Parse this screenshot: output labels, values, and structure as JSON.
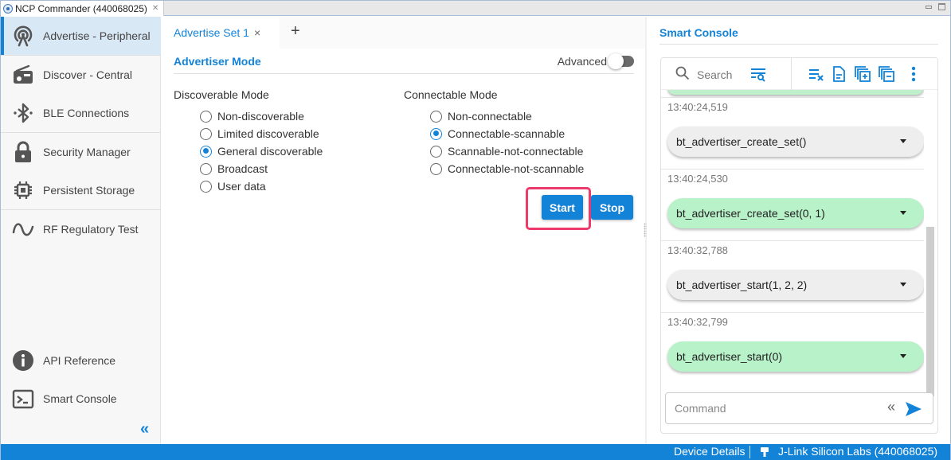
{
  "window": {
    "view_tab_title": "NCP Commander (440068025)"
  },
  "sidebar": {
    "items": [
      {
        "label": "Advertise - Peripheral",
        "icon": "broadcast-icon",
        "active": true
      },
      {
        "label": "Discover - Central",
        "icon": "radio-icon"
      },
      {
        "label": "BLE Connections",
        "icon": "bluetooth-icon"
      },
      {
        "label": "Security Manager",
        "icon": "lock-icon"
      },
      {
        "label": "Persistent Storage",
        "icon": "chip-icon"
      },
      {
        "label": "RF Regulatory Test",
        "icon": "sine-wave-icon"
      }
    ],
    "bottom_items": [
      {
        "label": "API Reference",
        "icon": "info-icon"
      },
      {
        "label": "Smart Console",
        "icon": "terminal-icon"
      }
    ],
    "collapse_glyph": "«"
  },
  "main": {
    "tabs": [
      {
        "label": "Advertise Set 1",
        "close": "×"
      }
    ],
    "add_tab": "+",
    "section_title": "Advertiser Mode",
    "advanced_label": "Advanced",
    "advanced_enabled": false,
    "discoverable": {
      "label": "Discoverable Mode",
      "options": [
        "Non-discoverable",
        "Limited discoverable",
        "General discoverable",
        "Broadcast",
        "User data"
      ],
      "selected": "General discoverable"
    },
    "connectable": {
      "label": "Connectable Mode",
      "options": [
        "Non-connectable",
        "Connectable-scannable",
        "Scannable-not-connectable",
        "Connectable-not-scannable"
      ],
      "selected": "Connectable-scannable"
    },
    "start_label": "Start",
    "stop_label": "Stop"
  },
  "console": {
    "title": "Smart Console",
    "search_placeholder": "Search",
    "entries": [
      {
        "timestamp": "13:40:24,519",
        "text": "bt_advertiser_create_set()",
        "kind": "command"
      },
      {
        "timestamp": "13:40:24,530",
        "text": "bt_advertiser_create_set(0, 1)",
        "kind": "response"
      },
      {
        "timestamp": "13:40:32,788",
        "text": "bt_advertiser_start(1, 2, 2)",
        "kind": "command"
      },
      {
        "timestamp": "13:40:32,799",
        "text": "bt_advertiser_start(0)",
        "kind": "response"
      }
    ],
    "command_placeholder": "Command",
    "history_glyph": "«"
  },
  "statusbar": {
    "device_details": "Device Details",
    "device": "J-Link Silicon Labs (440068025)"
  },
  "colors": {
    "accent": "#1383d8",
    "response_bg": "#b8f2c9",
    "command_bg": "#eeeeee",
    "highlight": "#ee3a6a"
  }
}
